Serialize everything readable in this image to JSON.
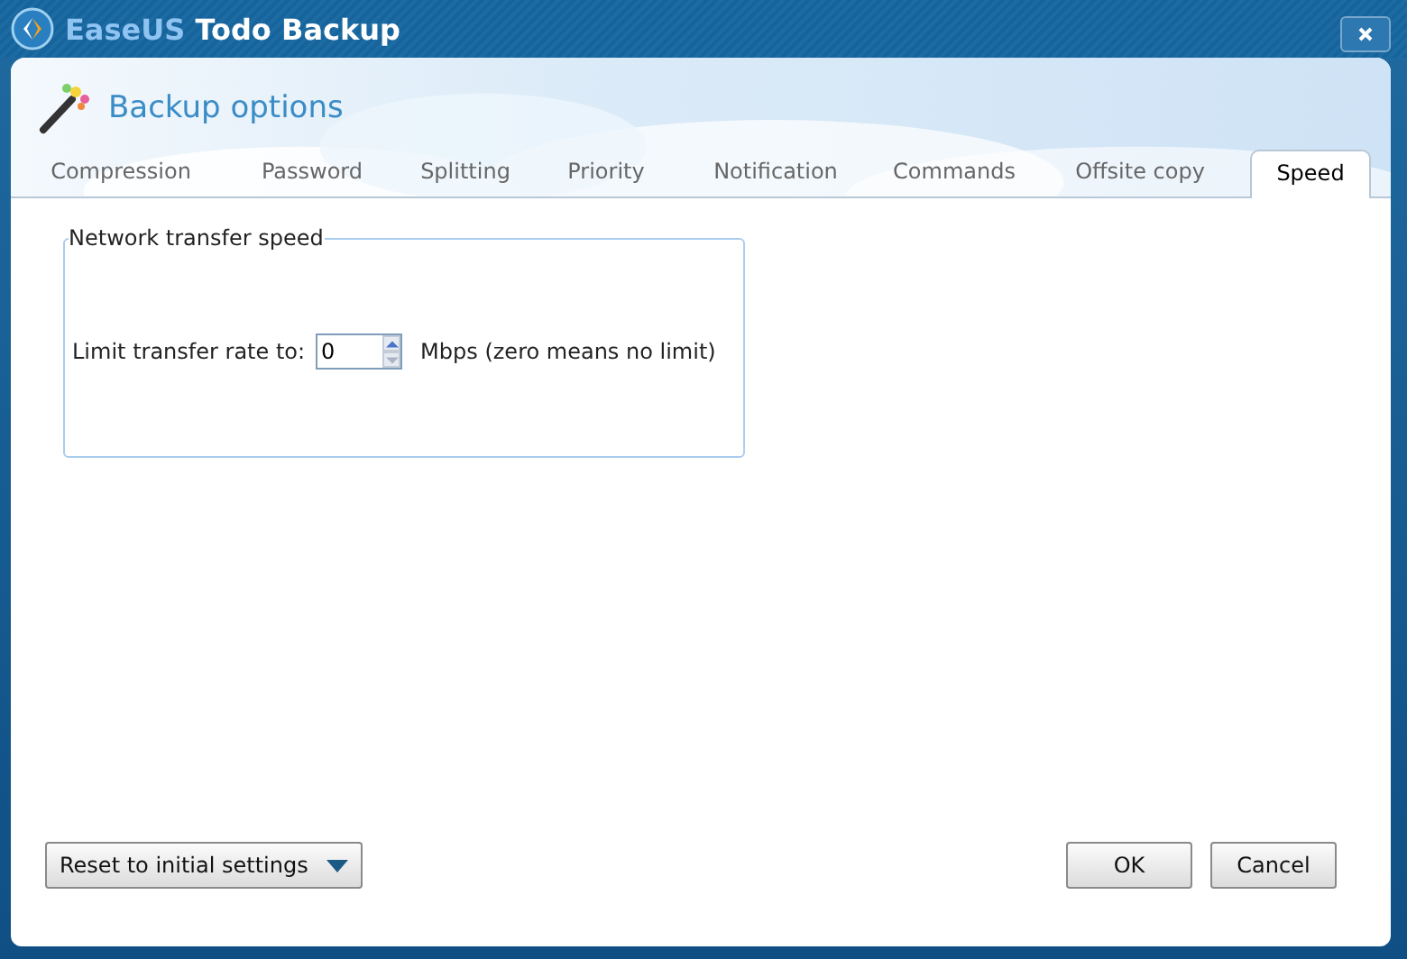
{
  "window": {
    "app_name_part1": "EaseUS",
    "app_name_part2": "Todo Backup"
  },
  "header": {
    "title": "Backup options"
  },
  "tabs": [
    {
      "label": "Compression",
      "selected": false
    },
    {
      "label": "Password",
      "selected": false
    },
    {
      "label": "Splitting",
      "selected": false
    },
    {
      "label": "Priority",
      "selected": false
    },
    {
      "label": "Notification",
      "selected": false
    },
    {
      "label": "Commands",
      "selected": false
    },
    {
      "label": "Offsite copy",
      "selected": false
    },
    {
      "label": "Speed",
      "selected": true
    }
  ],
  "group": {
    "title": "Network transfer speed",
    "label": "Limit transfer rate to:",
    "value": "0",
    "unit_note": "Mbps (zero means no limit)"
  },
  "buttons": {
    "reset": "Reset to initial settings",
    "ok": "OK",
    "cancel": "Cancel"
  }
}
